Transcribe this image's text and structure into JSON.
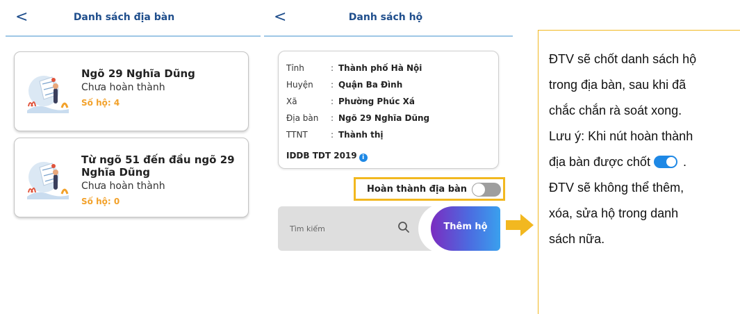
{
  "screen1": {
    "title": "Danh sách địa bàn",
    "back_label": "<",
    "areas": [
      {
        "name": "Ngõ 29 Nghĩa Dũng",
        "status": "Chưa hoàn thành",
        "count": "Số hộ: 4"
      },
      {
        "name": "Từ ngõ 51 đến đầu ngõ 29 Nghĩa Dũng",
        "status": "Chưa hoàn thành",
        "count": "Số hộ: 0"
      }
    ]
  },
  "screen2": {
    "title": "Danh sách hộ",
    "back_label": "<",
    "info": [
      {
        "label": "Tỉnh",
        "value": "Thành phố Hà Nội"
      },
      {
        "label": "Huyện",
        "value": "Quận Ba Đình"
      },
      {
        "label": "Xã",
        "value": "Phường Phúc Xá"
      },
      {
        "label": "Địa bàn",
        "value": "Ngõ 29 Nghĩa Dũng"
      },
      {
        "label": "TTNT",
        "value": "Thành thị"
      }
    ],
    "colon": ":",
    "iddb": "IDDB TDT 2019",
    "info_icon": "i",
    "complete_label": "Hoàn thành địa bàn",
    "complete_on": false,
    "search_placeholder": "Tìm kiếm",
    "add_label": "Thêm hộ"
  },
  "note": {
    "lines": [
      "ĐTV sẽ chốt danh sách hộ",
      "trong địa bàn, sau khi đã",
      "chắc chắn rà soát xong.",
      "Lưu ý: Khi nút hoàn thành",
      "địa bàn được chốt",
      "ĐTV sẽ không thể thêm,",
      "xóa, sửa hộ trong danh",
      "sách nữa."
    ],
    "toggle_suffix": "."
  },
  "colors": {
    "title": "#1f4e8c",
    "accent_orange": "#f2a12a",
    "highlight": "#f2b820",
    "toggle_on": "#1e88e5"
  }
}
